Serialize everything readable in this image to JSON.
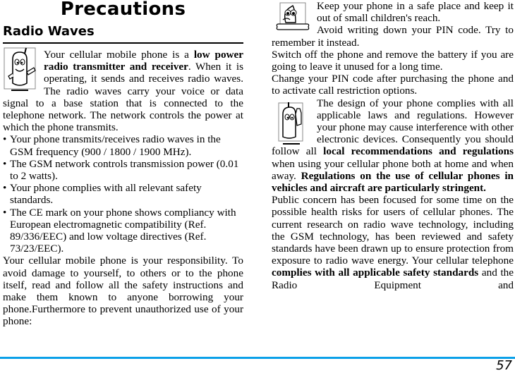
{
  "page": {
    "title": "Precautions",
    "page_number": "57",
    "accent_color": "#0aa0e8"
  },
  "left": {
    "section_heading": "Radio Waves",
    "intro": {
      "t1": "Your cellular mobile phone is a ",
      "b1": "low power radio transmitter and receiver",
      "t2": ". When it is operating, it sends and receives radio waves. The radio waves carry your voice or data signal to a base station that is connected to the telephone network. The network controls the power at which the phone transmits."
    },
    "bullets": [
      "Your phone transmits/receives radio waves in the GSM frequency (900 / 1800 / 1900 MHz).",
      "The GSM network controls transmission power (0.01 to 2 watts).",
      "Your phone complies with all relevant safety standards.",
      "The CE mark on your phone shows compliancy with European electromagnetic compatibility (Ref. 89/336/EEC) and low voltage directives (Ref. 73/23/EEC)."
    ],
    "bullet_char": "•",
    "responsibility": "Your cellular mobile phone is your responsibility. To avoid damage to yourself, to others or to the phone itself, read and follow all the safety instructions and make them known to anyone borrowing your phone.Furthermore to prevent unauthorized use of your phone:"
  },
  "right": {
    "keep_safe": "Keep your phone in a safe place and keep it out of small children's reach.",
    "pin_memory": "Avoid writing down your PIN code. Try to remember it instead.",
    "switch_off": "Switch off the phone and remove the battery if you are going to leave it unused for a long time.",
    "change_pin": "Change your PIN code after purchasing the phone and to activate call restriction options.",
    "design": {
      "t1": "The design of your phone complies with all applicable laws and regulations. However your phone may cause interference with other electronic devices. Consequently you should follow all ",
      "b1": "local recommendations and regulations",
      "t2": " when using your cellular phone both at home and when away. ",
      "b2": "Regulations on the use of cellular phones in vehicles and aircraft are particularly stringent."
    },
    "health": {
      "t1": "Public concern has been focused for some time on the possible health risks for users of cellular phones. The current research on radio wave technology, including the GSM technology, has been reviewed and safety standards have been drawn up to ensure protection from exposure to radio wave energy. Your cellular telephone ",
      "b1": "complies with all applicable safety standards",
      "t2": " and the Radio Equipment and"
    }
  },
  "icons": {
    "left_intro": "phone-mascot-pointing-icon",
    "right_keep_safe": "phone-mascot-dog-bone-icon",
    "right_design": "phone-mascot-stop-hand-icon"
  }
}
